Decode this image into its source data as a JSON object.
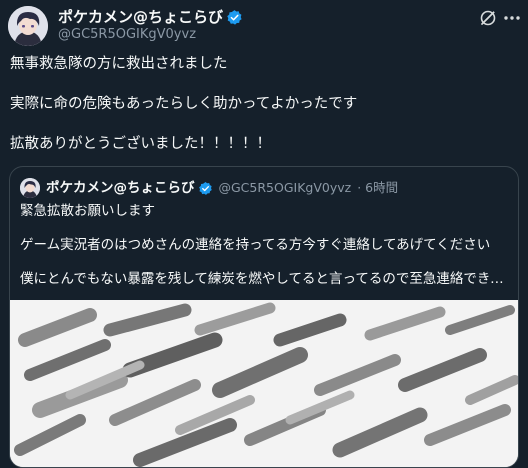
{
  "author": {
    "name": "ポケカメン@ちょこらび",
    "handle": "@GC5R5OGIKgV0yvz"
  },
  "icons": {
    "avatar": "avatar-image",
    "verified": "verified-badge-icon",
    "grok": "grok-icon",
    "more": "more-icon"
  },
  "tweet": {
    "lines": [
      "無事救急隊の方に救出されました",
      "実際に命の危険もあったらしく助かってよかったです",
      "拡散ありがとうございました！！！！！"
    ]
  },
  "quote": {
    "name": "ポケカメン@ちょこらび",
    "handle": "@GC5R5OGIKgV0yvz",
    "time": "· 6時間",
    "lines": [
      "緊急拡散お願いします",
      "ゲーム実況者のはつめさんの連絡を持ってる方今すぐ連絡してあげてください",
      "僕にとんでもない暴露を残して練炭を燃やしてると言ってるので至急連絡できる人今..."
    ]
  },
  "colors": {
    "background": "#15202b",
    "text": "#f7f9f9",
    "secondary": "#8b98a5",
    "border": "#38444d",
    "verified": "#1d9bf0"
  }
}
